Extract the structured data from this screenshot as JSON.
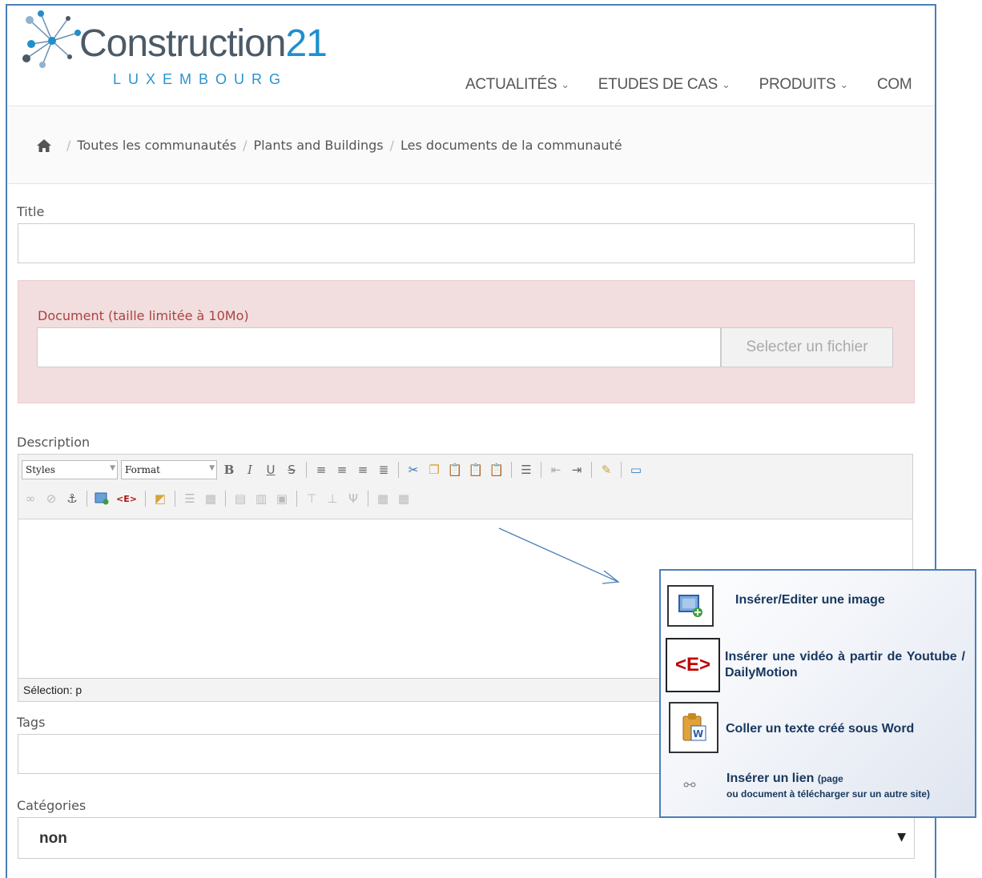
{
  "header": {
    "logo_main": "Construction",
    "logo_num": "21",
    "logo_sub": "LUXEMBOURG",
    "nav": [
      "ACTUALITÉS",
      "ETUDES DE CAS",
      "PRODUITS",
      "COM"
    ]
  },
  "breadcrumb": {
    "items": [
      "Toutes les communautés",
      "Plants and Buildings",
      "Les documents de la communauté"
    ]
  },
  "form": {
    "title_label": "Title",
    "title_value": "",
    "document_label": "Document (taille limitée à 10Mo)",
    "file_button": "Selecter un fichier",
    "description_label": "Description",
    "styles_combo": "Styles",
    "format_combo": "Format",
    "editor_status": "Sélection: p",
    "tags_label": "Tags",
    "categories_label": "Catégories",
    "categories_value": "non"
  },
  "callout": {
    "image_text": "Insérer/Editer une image",
    "video_text": "Insérer une vidéo à partir de Youtube / DailyMotion",
    "video_icon_text": "<E>",
    "word_text": "Coller un texte créé sous Word",
    "link_text": "Insérer un lien",
    "link_small_1": "(page",
    "link_small_2": "ou document à télécharger sur un autre site)"
  },
  "colors": {
    "brand_blue": "#1f8fce",
    "alert_bg": "#f2dede",
    "alert_text": "#a94442",
    "callout_text": "#17375e"
  }
}
